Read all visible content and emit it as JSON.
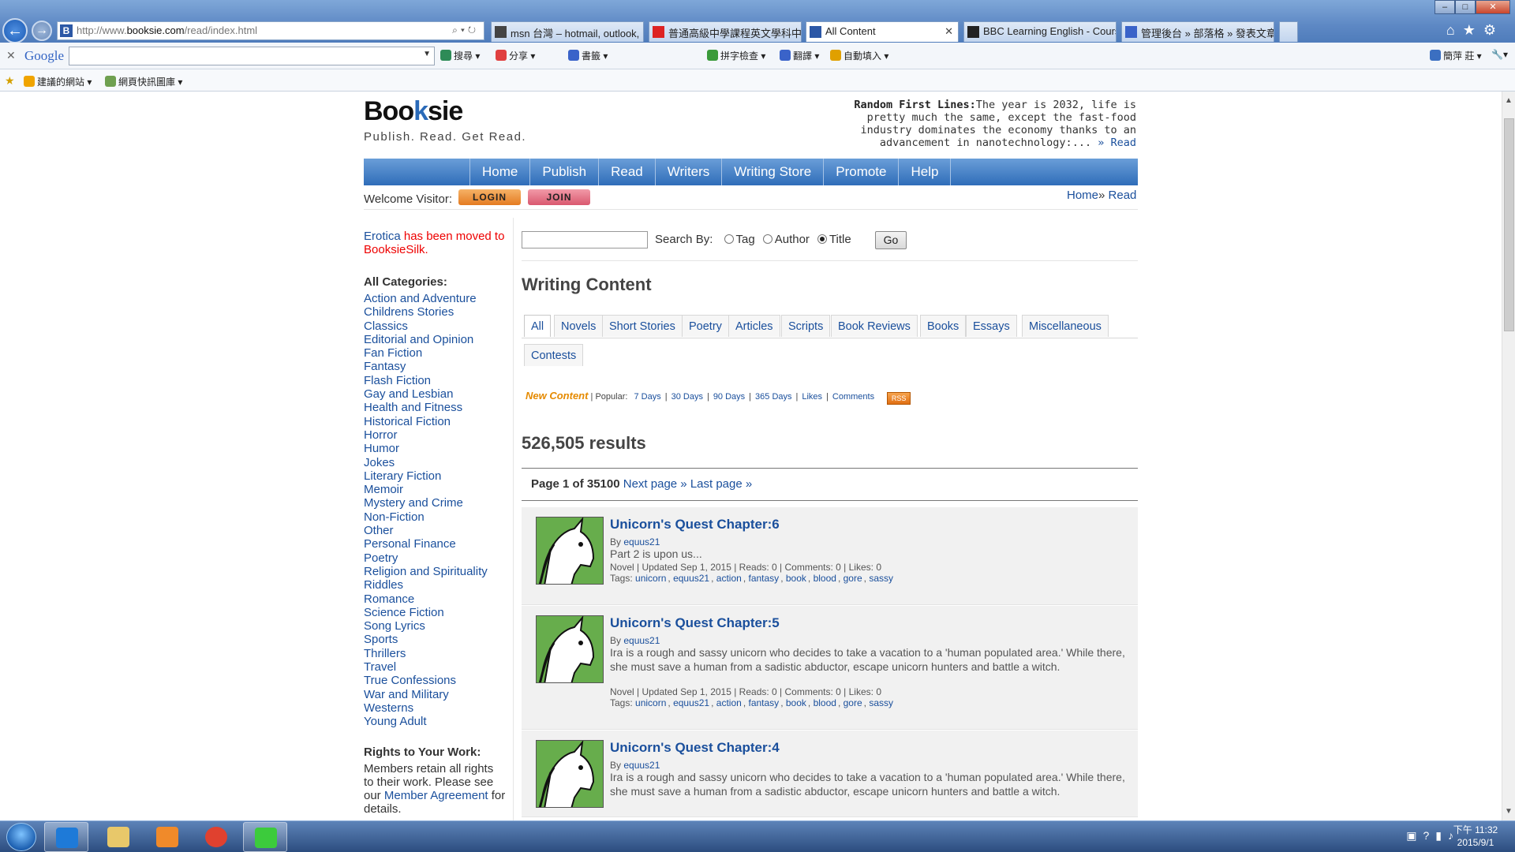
{
  "browser": {
    "url_prefix": "http://www.",
    "url_domain": "booksie.com",
    "url_path": "/read/index.html",
    "tabs": [
      {
        "label": "msn 台灣 – hotmail, outlook,",
        "icon": "msn-icon",
        "active": false
      },
      {
        "label": "普通高級中學課程英文學科中...",
        "icon": "pdf-icon",
        "active": false
      },
      {
        "label": "All Content",
        "icon": "booksie-icon",
        "active": true
      },
      {
        "label": "BBC Learning English - Cours...",
        "icon": "bbc-icon",
        "active": false
      },
      {
        "label": "管理後台 » 部落格 » 發表文章",
        "icon": "blog-icon",
        "active": false
      }
    ],
    "google_bar": {
      "logo": "Google",
      "items": [
        "搜尋",
        "分享",
        "書籤",
        "拼字檢查",
        "翻譯",
        "自動填入"
      ],
      "user": "簡萍 莊"
    },
    "favorites": [
      "建議的網站",
      "網頁快訊圖庫"
    ]
  },
  "site": {
    "logo_left": "Boo",
    "logo_k": "k",
    "logo_right": "sie",
    "tagline": "Publish. Read. Get Read.",
    "random_first_lines": {
      "label": "Random First Lines:",
      "text": "The year is 2032, life is pretty much the same, except the fast-food industry dominates the economy thanks to an advancement in nanotechnology:...",
      "more": "» Read"
    },
    "nav": [
      "Home",
      "Publish",
      "Read",
      "Writers",
      "Writing Store",
      "Promote",
      "Help"
    ],
    "welcome": "Welcome Visitor:",
    "login": "LOGIN",
    "join": "JOIN",
    "breadcrumb": {
      "home": "Home",
      "sep": "»",
      "current": "Read"
    }
  },
  "sidebar": {
    "erotica_link": "Erotica",
    "erotica_mid": " has been moved to ",
    "erotica_target": "BooksieSilk",
    "erotica_end": ".",
    "categories_heading": "All Categories:",
    "categories": [
      "Action and Adventure",
      "Childrens Stories",
      "Classics",
      "Editorial and Opinion",
      "Fan Fiction",
      "Fantasy",
      "Flash Fiction",
      "Gay and Lesbian",
      "Health and Fitness",
      "Historical Fiction",
      "Horror",
      "Humor",
      "Jokes",
      "Literary Fiction",
      "Memoir",
      "Mystery and Crime",
      "Non-Fiction",
      "Other",
      "Personal Finance",
      "Poetry",
      "Religion and Spirituality",
      "Riddles",
      "Romance",
      "Science Fiction",
      "Song Lyrics",
      "Sports",
      "Thrillers",
      "Travel",
      "True Confessions",
      "War and Military",
      "Westerns",
      "Young Adult"
    ],
    "rights_heading": "Rights to Your Work:",
    "rights_pre": "Members retain all rights to their work. Please see our ",
    "rights_link": "Member Agreement",
    "rights_post": " for details."
  },
  "search": {
    "label": "Search By:",
    "options": [
      "Tag",
      "Author",
      "Title"
    ],
    "selected": "Title",
    "go": "Go"
  },
  "content": {
    "heading": "Writing Content",
    "tabs": [
      "All",
      "Novels",
      "Short Stories",
      "Poetry",
      "Articles",
      "Scripts",
      "Book Reviews",
      "Books",
      "Essays",
      "Miscellaneous",
      "Contests"
    ],
    "active_tab": "All",
    "filter": {
      "new": "New Content",
      "popular": "Popular:",
      "links": [
        "7 Days",
        "30 Days",
        "90 Days",
        "365 Days",
        "Likes",
        "Comments"
      ],
      "rss": "RSS"
    },
    "results": "526,505 results",
    "pager": {
      "page": "Page 1 of 35100",
      "next": "Next page »",
      "last": "Last page »"
    },
    "entries": [
      {
        "title": "Unicorn's Quest Chapter:6",
        "by": "By",
        "author": "equus21",
        "desc": "Part 2 is upon us...",
        "meta": "Novel | Updated Sep 1, 2015 | Reads: 0 | Comments: 0 | Likes: 0",
        "tags_label": "Tags:",
        "tags": [
          "unicorn",
          "equus21",
          "action",
          "fantasy",
          "book",
          "blood",
          "gore",
          "sassy"
        ]
      },
      {
        "title": "Unicorn's Quest Chapter:5",
        "by": "By",
        "author": "equus21",
        "desc": "Ira is a rough and sassy unicorn who decides to take a vacation to a 'human populated area.' While there, she must save a human from a sadistic abductor, escape unicorn hunters and battle a witch.",
        "meta": "Novel | Updated Sep 1, 2015 | Reads: 0 | Comments: 0 | Likes: 0",
        "tags_label": "Tags:",
        "tags": [
          "unicorn",
          "equus21",
          "action",
          "fantasy",
          "book",
          "blood",
          "gore",
          "sassy"
        ]
      },
      {
        "title": "Unicorn's Quest Chapter:4",
        "by": "By",
        "author": "equus21",
        "desc": "Ira is a rough and sassy unicorn who decides to take a vacation to a 'human populated area.' While there, she must save a human from a sadistic abductor, escape unicorn hunters and battle a witch.",
        "meta": "",
        "tags_label": "",
        "tags": []
      }
    ]
  },
  "taskbar": {
    "apps": [
      "internet-explorer-icon",
      "file-explorer-icon",
      "media-player-icon",
      "chrome-icon",
      "line-icon"
    ],
    "time": "下午 11:32",
    "date": "2015/9/1"
  }
}
